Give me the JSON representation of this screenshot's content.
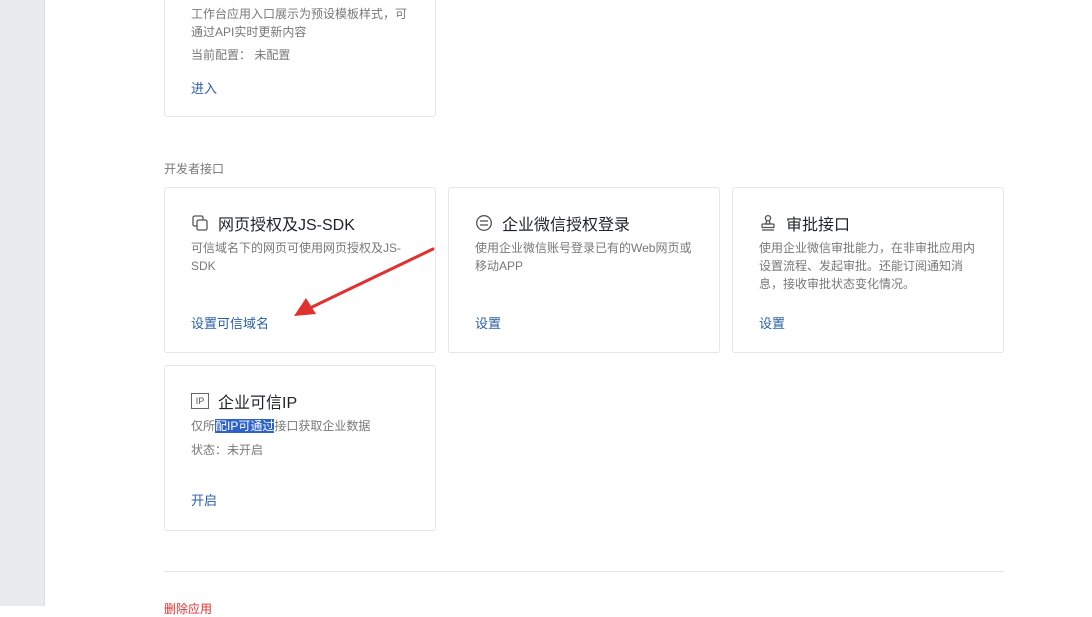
{
  "top_card": {
    "desc": "工作台应用入口展示为预设模板样式，可通过API实时更新内容",
    "config_label": "当前配置：",
    "config_value": "未配置",
    "link": "进入"
  },
  "section": {
    "title": "开发者接口"
  },
  "cards": {
    "web_auth": {
      "icon": "copy-icon",
      "title": "网页授权及JS-SDK",
      "desc": "可信域名下的网页可使用网页授权及JS-SDK",
      "link": "设置可信域名"
    },
    "wecom_login": {
      "icon": "login-icon",
      "title": "企业微信授权登录",
      "desc": "使用企业微信账号登录已有的Web网页或移动APP",
      "link": "设置"
    },
    "approval": {
      "icon": "stamp-icon",
      "title": "审批接口",
      "desc": "使用企业微信审批能力，在非审批应用内设置流程、发起审批。还能订阅通知消息，接收审批状态变化情况。",
      "link": "设置"
    },
    "trusted_ip": {
      "icon": "ip-icon",
      "icon_text": "IP",
      "title": "企业可信IP",
      "desc_pre": "仅所",
      "desc_selected": "配IP可通过",
      "desc_post": "接口获取企业数据",
      "status_label": "状态：",
      "status_value": "未开启",
      "link": "开启"
    }
  },
  "bottom": {
    "partial_text": "删除应用"
  },
  "colors": {
    "link": "#2a5fa6",
    "annotation_arrow": "#e0312e",
    "selection": "#2d62c8"
  }
}
